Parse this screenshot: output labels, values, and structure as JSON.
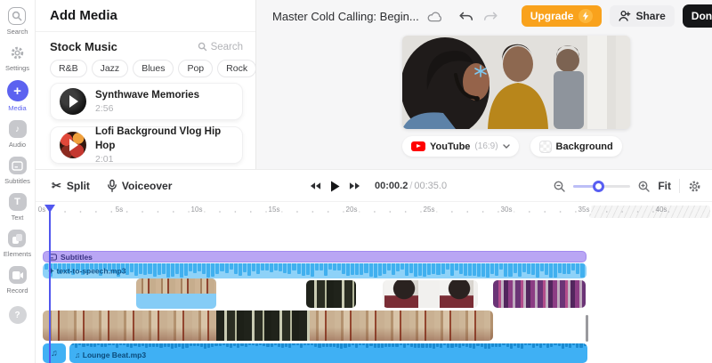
{
  "sidebar": {
    "items": [
      {
        "label": "Search"
      },
      {
        "label": "Settings"
      },
      {
        "label": "Media"
      },
      {
        "label": "Audio"
      },
      {
        "label": "Subtitles"
      },
      {
        "label": "Text"
      },
      {
        "label": "Elements"
      },
      {
        "label": "Record"
      }
    ],
    "help_label": "?"
  },
  "media_panel": {
    "title": "Add Media",
    "section_title": "Stock Music",
    "search_label": "Search",
    "genres": [
      "R&B",
      "Jazz",
      "Blues",
      "Pop",
      "Rock"
    ],
    "more_label": "•••",
    "items": [
      {
        "title": "Synthwave Memories",
        "duration": "2:56"
      },
      {
        "title": "Lofi Background Vlog Hip Hop",
        "duration": "2:01"
      }
    ]
  },
  "header": {
    "project_title": "Master Cold Calling: Begin...",
    "upgrade_label": "Upgrade",
    "share_label": "Share",
    "done_label": "Done"
  },
  "preview": {
    "canvas_label": "YouTube",
    "aspect_ratio": "(16:9)",
    "background_label": "Background"
  },
  "timeline": {
    "split_label": "Split",
    "voiceover_label": "Voiceover",
    "current_time": "00:00.2",
    "separator": "/",
    "total_time": "00:35.0",
    "fit_label": "Fit",
    "ruler_labels": [
      "0s",
      "5s",
      "10s",
      "15s",
      "20s",
      "25s",
      "30s",
      "35s",
      "40s"
    ],
    "tracks": {
      "subtitles_label": "Subtitles",
      "tts_label": "text-to-speech.mp3",
      "music_label": "Lounge Beat.mp3"
    }
  },
  "colors": {
    "accent_blue": "#5c62f0",
    "playhead_blue": "#5157ee",
    "upgrade_orange": "#f9a21c",
    "track_purple": "#b9a6f4",
    "track_blue": "#41b1f4",
    "done_black": "#151618"
  }
}
